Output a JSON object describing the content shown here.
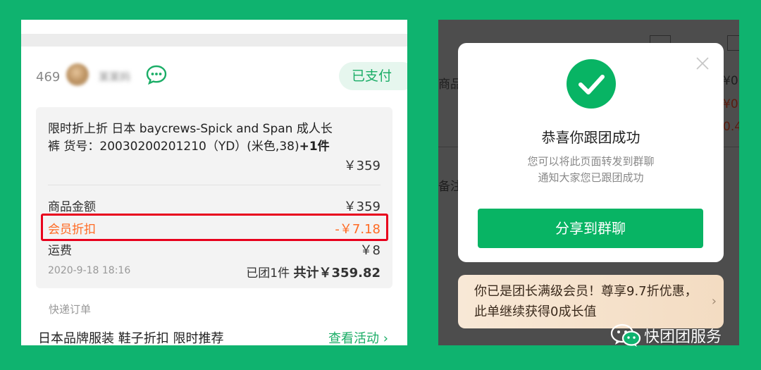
{
  "left": {
    "order_num": "469",
    "username": "某某妈",
    "status": "已支付",
    "product": {
      "name": "限时折上折 日本 baycrews-Spick and Span 成人长裤 货号：20030200201210（YD）(米色,38)",
      "qty": "+1件",
      "price": "￥359"
    },
    "rows": [
      {
        "label": "商品金额",
        "value": "￥359"
      },
      {
        "label": "会员折扣",
        "value": "-￥7.18"
      },
      {
        "label": "运费",
        "value": "￥8"
      }
    ],
    "date": "2020-9-18 18:16",
    "summary": {
      "count": "已团1件",
      "total_label": "共计",
      "total": "￥359.82"
    },
    "express_label": "快递订单",
    "promo": {
      "text": "日本品牌服装 鞋子折扣 限时推荐",
      "link": "查看活动"
    },
    "accent": "#1aad66",
    "discount_color": "#ff6a23",
    "highlight_color": "#e8001c"
  },
  "right": {
    "background_fragments": [
      "商品",
      "备注",
      "¥0.",
      "¥0.0",
      "0.4"
    ],
    "dialog": {
      "title": "恭喜你跟团成功",
      "subtitle_line1": "您可以将此页面转发到群聊",
      "subtitle_line2": "通知大家您已跟团成功",
      "button": "分享到群聊",
      "icon": "check-circle-icon",
      "accent": "#08b464"
    },
    "member_banner": "你已是团长满级会员！尊享9.7折优惠，此单继续获得0成长值"
  },
  "watermark": "快团团服务"
}
